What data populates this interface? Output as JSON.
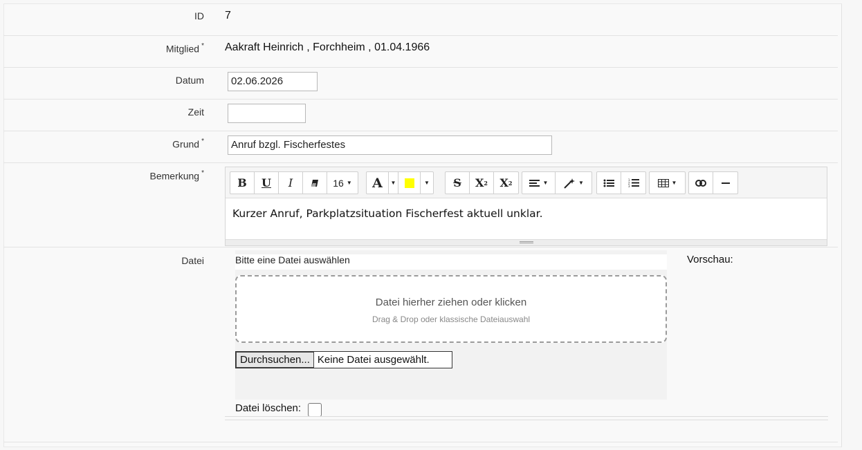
{
  "form": {
    "id": {
      "label": "ID",
      "value": "7"
    },
    "mitglied": {
      "label": "Mitglied",
      "required": "*",
      "value": "Aakraft Heinrich , Forchheim , 01.04.1966"
    },
    "datum": {
      "label": "Datum",
      "value": "02.06.2026"
    },
    "zeit": {
      "label": "Zeit",
      "value": ""
    },
    "grund": {
      "label": "Grund",
      "required": "*",
      "value": "Anruf bzgl. Fischerfestes"
    },
    "bemerkung": {
      "label": "Bemerkung",
      "required": "*",
      "text": "Kurzer Anruf, Parkplatzsituation Fischerfest aktuell unklar."
    },
    "datei": {
      "label": "Datei",
      "hint": "Bitte eine Datei auswählen",
      "dropzone_title": "Datei hierher ziehen oder klicken",
      "dropzone_sub": "Drag & Drop oder klassische Dateiauswahl",
      "browse_label": "Durchsuchen...",
      "no_file": "Keine Datei ausgewählt.",
      "delete_label": "Datei löschen:",
      "delete_checked": false,
      "preview_label": "Vorschau:"
    }
  },
  "toolbar": {
    "font_size": "16",
    "highlight_color": "#ffff00",
    "tools": [
      "bold-icon",
      "underline-icon",
      "italic-icon",
      "eraser-icon",
      "font-size",
      "font-color-icon",
      "highlight-color-icon",
      "strikethrough-icon",
      "superscript-icon",
      "subscript-icon",
      "align-icon",
      "magic-icon",
      "unordered-list-icon",
      "ordered-list-icon",
      "table-icon",
      "link-icon",
      "horizontal-rule-icon"
    ]
  }
}
